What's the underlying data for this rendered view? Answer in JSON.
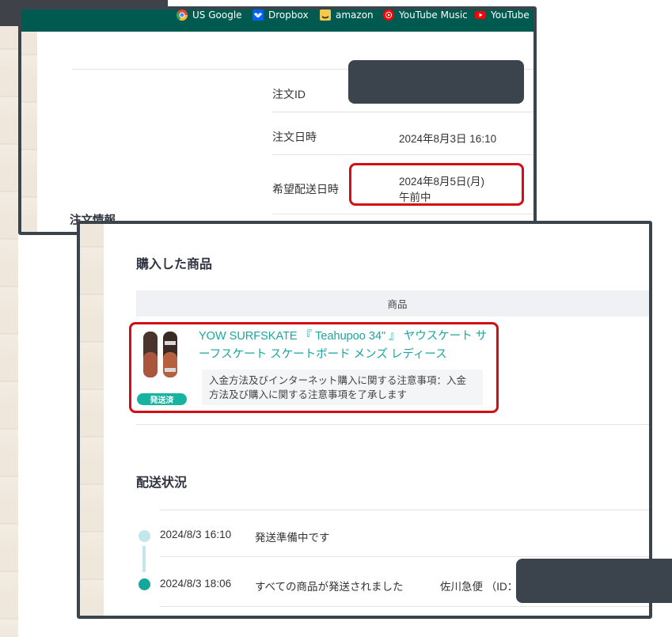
{
  "bookmarks": [
    {
      "label": "US Google",
      "icon": "chrome-icon"
    },
    {
      "label": "Dropbox",
      "icon": "dropbox-icon"
    },
    {
      "label": "amazon",
      "icon": "amazon-icon"
    },
    {
      "label": "YouTube Music",
      "icon": "youtube-music-icon"
    },
    {
      "label": "YouTube",
      "icon": "youtube-icon"
    }
  ],
  "order": {
    "section_title": "注文情報",
    "rows": [
      {
        "label": "注文ID",
        "value": ""
      },
      {
        "label": "注文日時",
        "value": "2024年8月3日 16:10"
      },
      {
        "label": "希望配送日時",
        "value": "2024年8月5日(月)",
        "value2": "午前中"
      }
    ]
  },
  "purchased": {
    "title": "購入した商品",
    "column_header": "商品",
    "product_name": "YOW SURFSKATE 『 Teahupoo 34\" 』 ヤウスケート サーフスケート スケートボード メンズ レディース",
    "note": "入金方法及びインターネット購入に関する注意事項：入金方法及び購入に関する注意事項を了承します",
    "status_badge": "発送済"
  },
  "shipping": {
    "title": "配送状況",
    "events": [
      {
        "datetime": "2024/8/3 16:10",
        "text": "発送準備中です",
        "carrier": ""
      },
      {
        "datetime": "2024/8/3 18:06",
        "text": "すべての商品が発送されました",
        "carrier": "佐川急便 （ID："
      }
    ]
  },
  "colors": {
    "accent": "#19a6a0",
    "highlight": "#d40c14",
    "redaction": "#3b444d",
    "bookmark_bar": "#005a50"
  }
}
